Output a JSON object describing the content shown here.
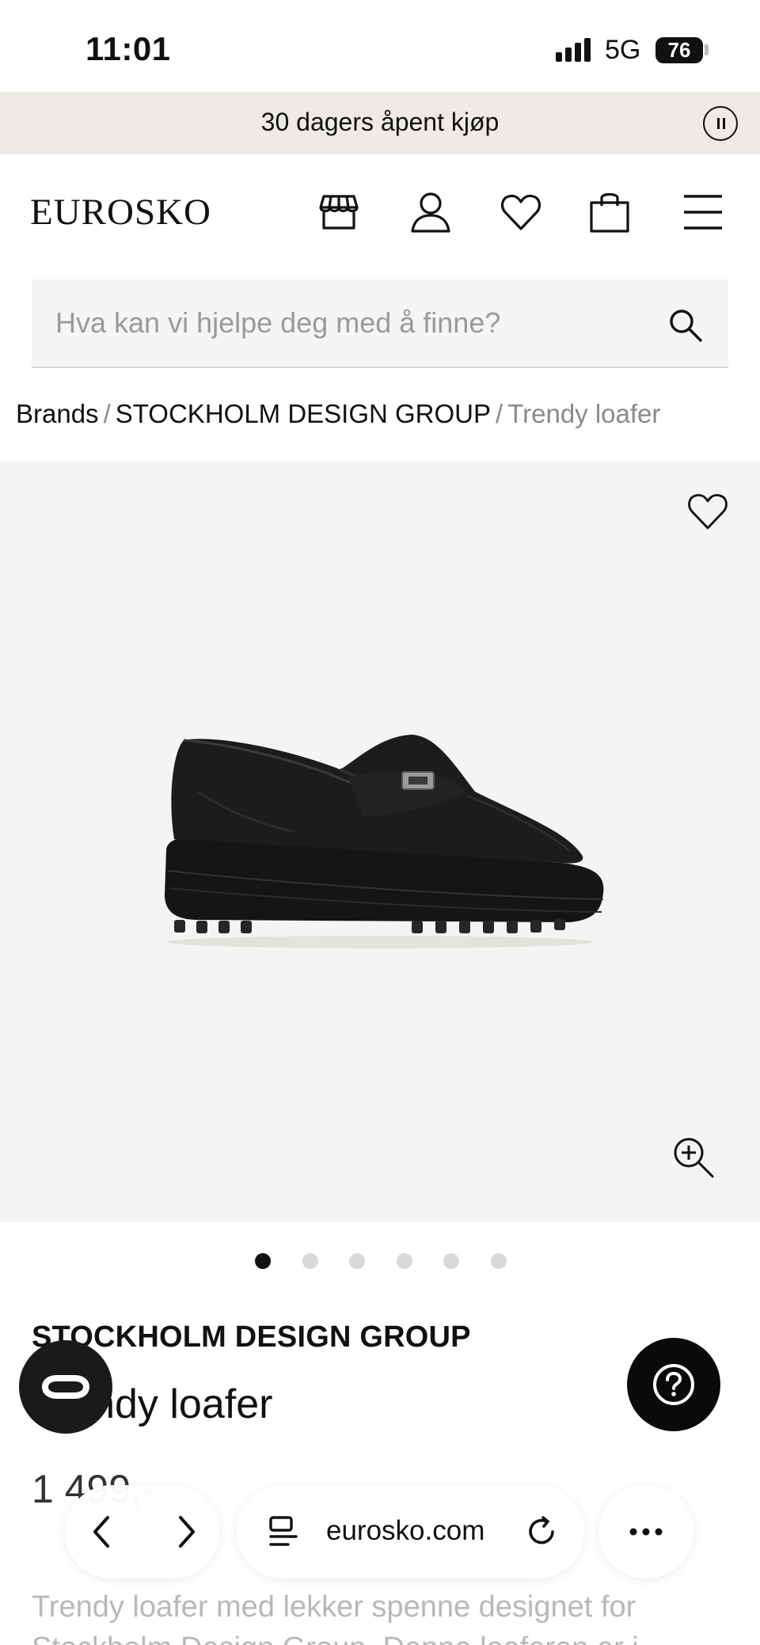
{
  "status_bar": {
    "time": "11:01",
    "network": "5G",
    "battery": "76"
  },
  "promo": {
    "text": "30 dagers åpent kjøp"
  },
  "header": {
    "logo": "EUROSKO"
  },
  "search": {
    "placeholder": "Hva kan vi hjelpe deg med å finne?"
  },
  "breadcrumb": {
    "items": [
      "Brands",
      "STOCKHOLM DESIGN GROUP"
    ],
    "separator": "/",
    "current": "Trendy loafer"
  },
  "gallery": {
    "image_count": 6,
    "active_index": 0
  },
  "product": {
    "brand": "STOCKHOLM DESIGN GROUP",
    "name": "Trendy loafer",
    "price": "1 499,-",
    "description": "Trendy loafer med lekker spenne designet for Stockholm Design Group. Denne loaferen er i"
  },
  "browser": {
    "url": "eurosko.com"
  },
  "colors": {
    "promo_bg": "#eeebe6",
    "gallery_bg": "#f5f4f2",
    "text": "#111111",
    "muted": "#8a8a8a"
  }
}
